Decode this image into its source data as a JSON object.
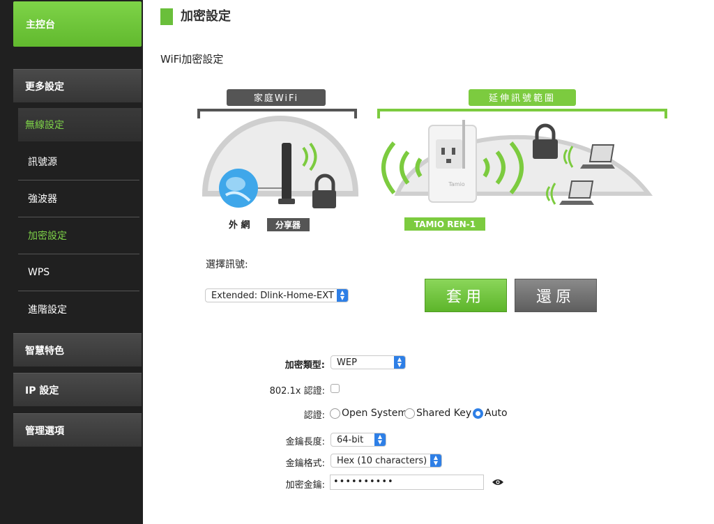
{
  "sidebar": {
    "home": "主控台",
    "more_settings": "更多設定",
    "wireless_settings": "無線設定",
    "items": [
      {
        "label": "訊號源",
        "active": false
      },
      {
        "label": "強波器",
        "active": false
      },
      {
        "label": "加密設定",
        "active": true
      },
      {
        "label": "WPS",
        "active": false
      },
      {
        "label": "進階設定",
        "active": false
      }
    ],
    "smart_features": "智慧特色",
    "ip_settings": "IP 設定",
    "management": "管理選項"
  },
  "header": {
    "title": "加密設定",
    "section": "WiFi加密設定"
  },
  "diagram": {
    "home_wifi": "家庭WiFi",
    "extend_range": "延伸訊號範圍",
    "internet": "外 網",
    "router": "分享器",
    "device_model": "TAMIO REN-1",
    "device_brand": "Tamio"
  },
  "signal": {
    "label": "選擇訊號:",
    "selected": "Extended: Dlink-Home-EXT"
  },
  "buttons": {
    "apply": "套用",
    "restore": "還原"
  },
  "form": {
    "enc_type_label": "加密類型:",
    "enc_type_value": "WEP",
    "dot1x_label": "802.1x 認證:",
    "auth_label": "認證:",
    "auth_options": [
      "Open System",
      "Shared Key",
      "Auto"
    ],
    "auth_selected": "Auto",
    "key_length_label": "金鑰長度:",
    "key_length_value": "64-bit",
    "key_format_label": "金鑰格式:",
    "key_format_value": "Hex (10 characters)",
    "key_label": "加密金鑰:",
    "key_value": "••••••••••"
  },
  "colors": {
    "accent_green": "#6abf3b",
    "sidebar_bg": "#202020",
    "select_blue": "#2e7fe6"
  }
}
